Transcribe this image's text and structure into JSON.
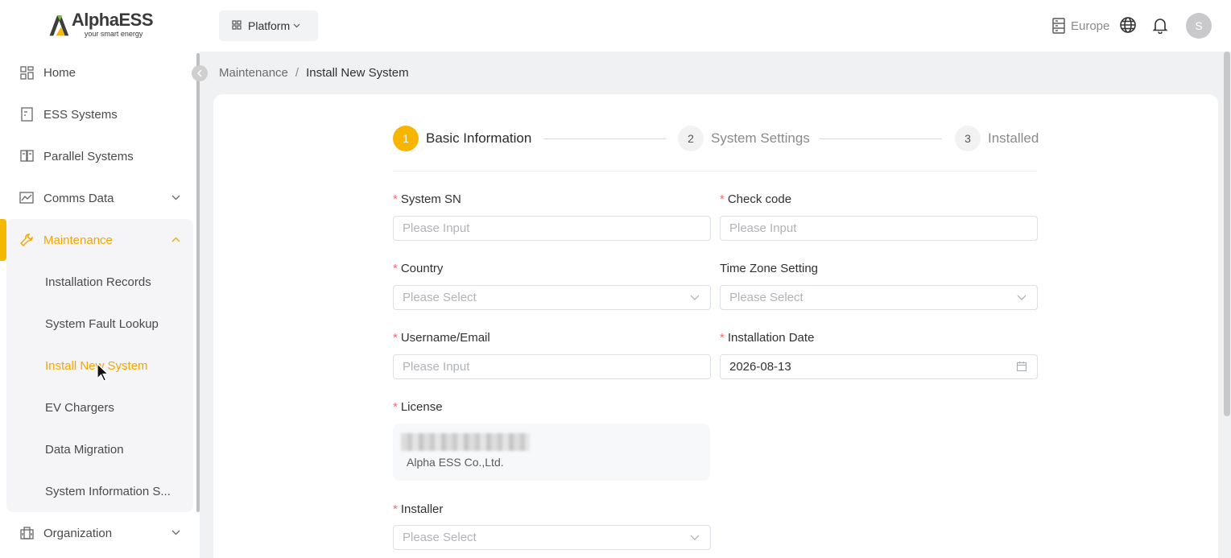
{
  "brand": {
    "name": "AlphaESS",
    "tagline": "your smart energy",
    "accent": "#f5a500"
  },
  "sidebar": {
    "items": [
      {
        "label": "Home",
        "icon": "dashboard-icon"
      },
      {
        "label": "ESS Systems",
        "icon": "document-icon"
      },
      {
        "label": "Parallel Systems",
        "icon": "book-icon"
      },
      {
        "label": "Comms Data",
        "icon": "chart-icon"
      },
      {
        "label": "Maintenance",
        "icon": "wrench-icon"
      },
      {
        "label": "Organization",
        "icon": "building-icon"
      }
    ],
    "maintenance_sub": [
      {
        "label": "Installation Records"
      },
      {
        "label": "System Fault Lookup"
      },
      {
        "label": "Install New System"
      },
      {
        "label": "EV Chargers"
      },
      {
        "label": "Data Migration"
      },
      {
        "label": "System Information S..."
      }
    ]
  },
  "topbar": {
    "platform_label": "Platform",
    "region": "Europe",
    "avatar_initial": "S"
  },
  "breadcrumb": {
    "parent": "Maintenance",
    "separator": "/",
    "current": "Install New System"
  },
  "steps": [
    {
      "number": "1",
      "label": "Basic Information",
      "active": true
    },
    {
      "number": "2",
      "label": "System Settings",
      "active": false
    },
    {
      "number": "3",
      "label": "Installed",
      "active": false
    }
  ],
  "form": {
    "system_sn": {
      "label": "System SN",
      "placeholder": "Please Input"
    },
    "check_code": {
      "label": "Check code",
      "placeholder": "Please Input"
    },
    "country": {
      "label": "Country",
      "placeholder": "Please Select"
    },
    "time_zone": {
      "label": "Time Zone Setting",
      "placeholder": "Please Select"
    },
    "username": {
      "label": "Username/Email",
      "placeholder": "Please Input"
    },
    "install_date": {
      "label": "Installation Date",
      "value": "2026-08-13"
    },
    "license": {
      "label": "License",
      "company": "Alpha ESS Co.,Ltd."
    },
    "installer": {
      "label": "Installer",
      "placeholder": "Please Select"
    },
    "required_mark": "*"
  }
}
